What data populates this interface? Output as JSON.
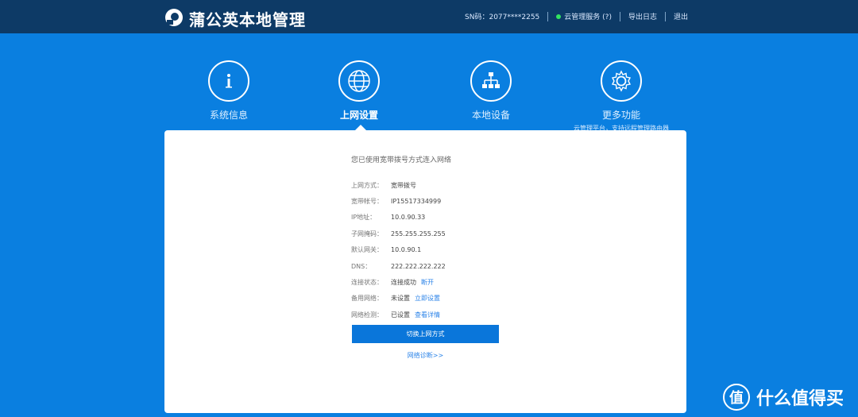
{
  "app": {
    "title": "蒲公英本地管理"
  },
  "header": {
    "sn": "SN码：2077****2255",
    "cloud_service": "云管理服务 (?)",
    "export_log": "导出日志",
    "logout": "退出",
    "status_color": "#32e35f"
  },
  "nav": {
    "items": [
      {
        "label": "系统信息",
        "icon": "info-icon"
      },
      {
        "label": "上网设置",
        "icon": "globe-icon"
      },
      {
        "label": "本地设备",
        "icon": "network-tree-icon"
      },
      {
        "label": "更多功能",
        "icon": "gear-icon",
        "sub": "云管理平台，支持远程管理路由器"
      }
    ]
  },
  "panel": {
    "title": "您已使用宽带拨号方式连入网络",
    "rows": [
      {
        "k": "上网方式：",
        "v": "宽带拨号",
        "link": ""
      },
      {
        "k": "宽带帐号：",
        "v": "IP15517334999",
        "link": ""
      },
      {
        "k": "IP地址：",
        "v": "10.0.90.33",
        "link": ""
      },
      {
        "k": "子网掩码：",
        "v": "255.255.255.255",
        "link": ""
      },
      {
        "k": "默认网关：",
        "v": "10.0.90.1",
        "link": ""
      },
      {
        "k": "DNS：",
        "v": "222.222.222.222",
        "link": ""
      },
      {
        "k": "连接状态：",
        "v": "连接成功",
        "link": "断开"
      },
      {
        "k": "备用网络：",
        "v": "未设置",
        "link": "立即设置"
      },
      {
        "k": "网络检测：",
        "v": "已设置",
        "link": "查看详情"
      }
    ],
    "button": "切换上网方式",
    "diagnose": "网络诊断>>"
  },
  "watermark": {
    "text": "什么值得买"
  }
}
